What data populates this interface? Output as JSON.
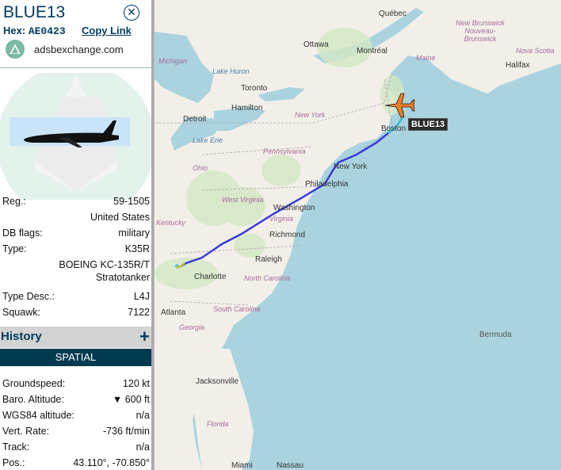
{
  "aircraft": {
    "callsign": "BLUE13",
    "hex_label": "Hex:",
    "hex": "AE0423",
    "copy_link": "Copy Link",
    "source": "adsbexchange.com"
  },
  "details": [
    {
      "label": "Reg.:",
      "value": "59-1505"
    },
    {
      "label": "",
      "value": "United States"
    },
    {
      "label": "DB flags:",
      "value": "military"
    },
    {
      "label": "Type:",
      "value": "K35R"
    },
    {
      "label": "",
      "value": "BOEING KC-135R/T"
    },
    {
      "label": "",
      "value": "Stratotanker"
    },
    {
      "label": "Type Desc.:",
      "value": "L4J"
    },
    {
      "label": "Squawk:",
      "value": "7122"
    }
  ],
  "history": {
    "title": "History",
    "plus": "+",
    "tab": "SPATIAL"
  },
  "spatial": [
    {
      "label": "Groundspeed:",
      "value": "120 kt"
    },
    {
      "label": "Baro. Altitude:",
      "value": "▼ 600 ft"
    },
    {
      "label": "WGS84 altitude:",
      "value": "n/a"
    },
    {
      "label": "Vert. Rate:",
      "value": "-736 ft/min"
    },
    {
      "label": "Track:",
      "value": "n/a"
    },
    {
      "label": "Pos.:",
      "value": "43.110°, -70.850°"
    }
  ],
  "map": {
    "cities": [
      "Québec",
      "Ottawa",
      "Montréal",
      "Toronto",
      "Hamilton",
      "Detroit",
      "Boston",
      "New York",
      "Philadelphia",
      "Washington",
      "Richmond",
      "Raleigh",
      "Charlotte",
      "Atlanta",
      "Jacksonville",
      "Halifax",
      "Miami",
      "Nassau"
    ],
    "regions": [
      "New Brunswick Nouveau-Brunswick",
      "Nova Scotia",
      "Maine",
      "Michigan",
      "New York",
      "Pennsylvania",
      "Ohio",
      "West Virginia",
      "Virginia",
      "Kentucky",
      "North Carolina",
      "South Carolina",
      "Georgia",
      "Florida"
    ],
    "water": [
      "Lake Huron",
      "Lake Erie",
      "Bermuda"
    ],
    "aircraft_label": "BLUE13",
    "colors": {
      "track": "#3b3bd6",
      "aircraft": "#f07d2a"
    }
  }
}
